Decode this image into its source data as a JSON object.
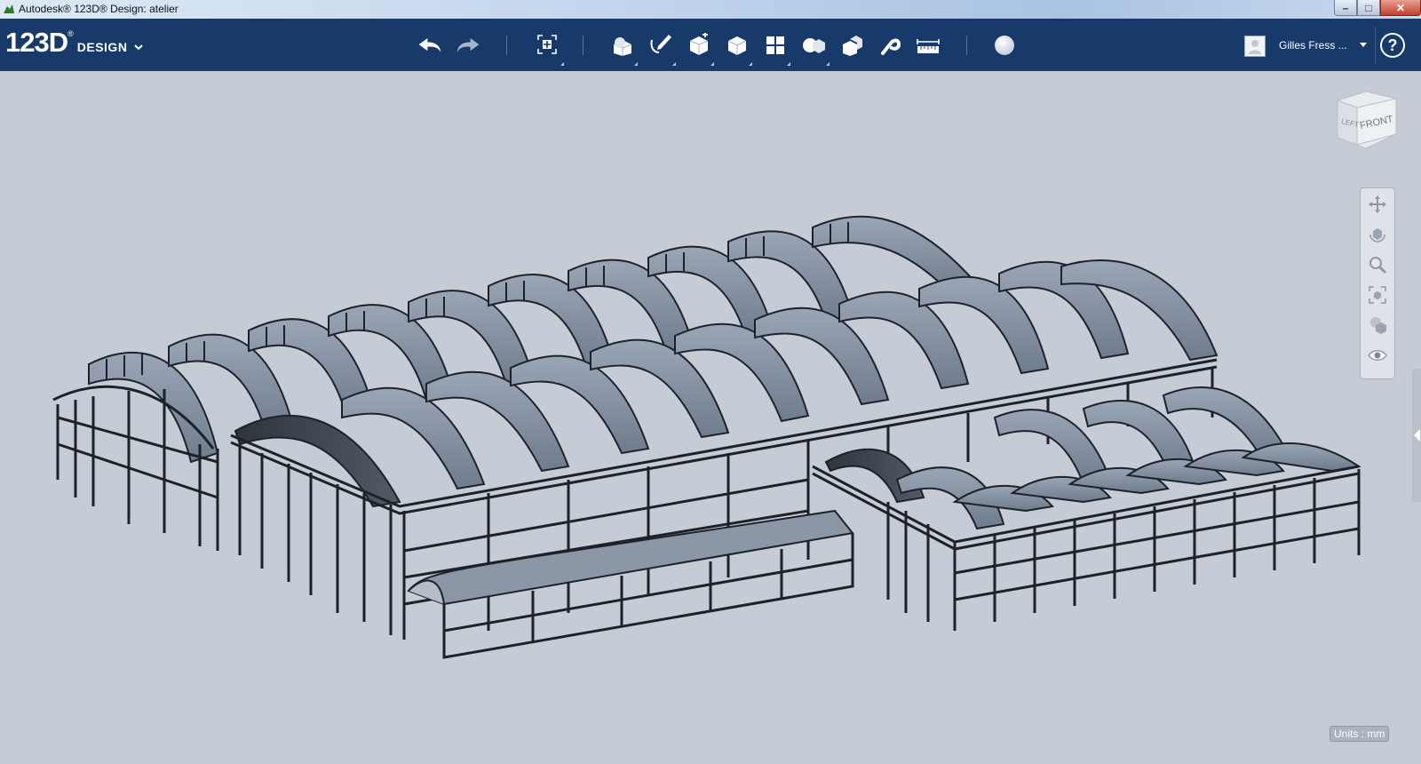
{
  "window": {
    "title": "Autodesk® 123D® Design: atelier",
    "minimize_glyph": "–",
    "maximize_glyph": "□",
    "close_glyph": "✕"
  },
  "logo": {
    "main": "123D",
    "sup": "®",
    "sub": "DESIGN"
  },
  "toolbar": {
    "tools": [
      "undo-icon",
      "redo-icon",
      "transform-icon",
      "primitives-icon",
      "sketch-icon",
      "construct-icon",
      "modify-icon",
      "pattern-icon",
      "grouping-icon",
      "combine-icon",
      "snap-icon",
      "measure-icon",
      "material-icon"
    ]
  },
  "user": {
    "name": "Gilles Fress ..."
  },
  "help": {
    "label": "?"
  },
  "viewcube": {
    "left": "LEFT",
    "front": "FRONT"
  },
  "navbar": {
    "tools": [
      "pan-icon",
      "orbit-icon",
      "zoom-icon",
      "fit-icon",
      "view-mode-icon",
      "visibility-icon"
    ]
  },
  "status": {
    "units": "Units : mm"
  },
  "colors": {
    "toolbar": "#173a6b",
    "viewport": "#c5ccd6",
    "glass": "#8a97a8",
    "frame": "#1e2228"
  }
}
